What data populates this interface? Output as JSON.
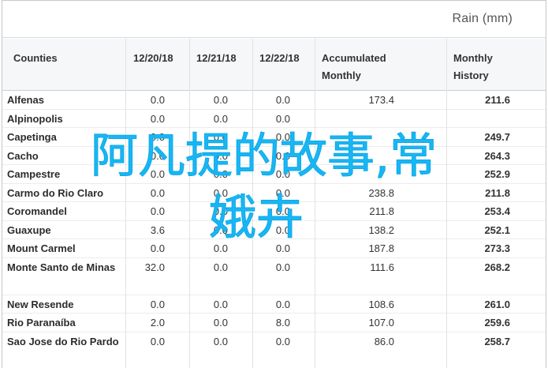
{
  "header": {
    "unit_label": "Rain (mm)"
  },
  "columns": {
    "counties": "Counties",
    "d1": "12/20/18",
    "d2": "12/21/18",
    "d3": "12/22/18",
    "acc_line1": "Accumulated",
    "acc_line2": "Monthly",
    "hist_line1": "Monthly",
    "hist_line2": "History"
  },
  "rows": [
    {
      "county": "Alfenas",
      "d1": "0.0",
      "d2": "0.0",
      "d3": "0.0",
      "acc": "173.4",
      "hist": "211.6"
    },
    {
      "county": "Alpinopolis",
      "d1": "0.0",
      "d2": "0.0",
      "d3": "0.0",
      "acc": "",
      "hist": ""
    },
    {
      "county": "Capetinga",
      "d1": "0.0",
      "d2": "0.0",
      "d3": "0.0",
      "acc": "",
      "hist": "249.7"
    },
    {
      "county": "Cacho",
      "d1": "0.0",
      "d2": "0.0",
      "d3": "0.0",
      "acc": "",
      "hist": "264.3"
    },
    {
      "county": "Campestre",
      "d1": "0.0",
      "d2": "0.0",
      "d3": "0.0",
      "acc": "",
      "hist": "252.9"
    },
    {
      "county": "Carmo do Rio Claro",
      "d1": "0.0",
      "d2": "0.0",
      "d3": "0.0",
      "acc": "238.8",
      "hist": "211.8"
    },
    {
      "county": "Coromandel",
      "d1": "0.0",
      "d2": "0.0",
      "d3": "0.0",
      "acc": "211.8",
      "hist": "253.4"
    },
    {
      "county": "Guaxupe",
      "d1": "3.6",
      "d2": "0.0",
      "d3": "0.0",
      "acc": "138.2",
      "hist": "252.1"
    },
    {
      "county": "Mount Carmel",
      "d1": "0.0",
      "d2": "0.0",
      "d3": "0.0",
      "acc": "187.8",
      "hist": "273.3"
    },
    {
      "county": "Monte Santo de Minas",
      "d1": "32.0",
      "d2": "0.0",
      "d3": "0.0",
      "acc": "111.6",
      "hist": "268.2",
      "tall": true
    },
    {
      "county": "New Resende",
      "d1": "0.0",
      "d2": "0.0",
      "d3": "0.0",
      "acc": "108.6",
      "hist": "261.0"
    },
    {
      "county": "Rio Paranaíba",
      "d1": "2.0",
      "d2": "0.0",
      "d3": "8.0",
      "acc": "107.0",
      "hist": "259.6"
    },
    {
      "county": "Sao Jose do Rio Pardo",
      "d1": "0.0",
      "d2": "0.0",
      "d3": "0.0",
      "acc": "86.0",
      "hist": "258.7",
      "tall": true
    }
  ],
  "watermark": {
    "line1": "阿凡提的故事,常",
    "line2": "娥卉"
  },
  "colors": {
    "watermark": "#19b6f4",
    "header_bg": "#f6f7f8"
  }
}
